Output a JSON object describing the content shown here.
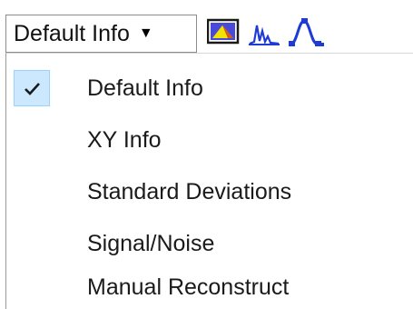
{
  "toolbar": {
    "dropdown_value": "Default Info",
    "dropdown_caret_icon": "caret-down-icon",
    "icons": [
      "image-view-icon",
      "spectrum-peaks-icon",
      "peak-shape-icon"
    ]
  },
  "menu": {
    "items": [
      {
        "label": "Default Info",
        "checked": true
      },
      {
        "label": "XY Info",
        "checked": false
      },
      {
        "label": "Standard Deviations",
        "checked": false
      },
      {
        "label": "Signal/Noise",
        "checked": false
      },
      {
        "label": "Manual Reconstruct",
        "checked": false
      }
    ]
  },
  "colors": {
    "accent_blue": "#1f3bd6",
    "check_highlight": "#cce8ff"
  }
}
